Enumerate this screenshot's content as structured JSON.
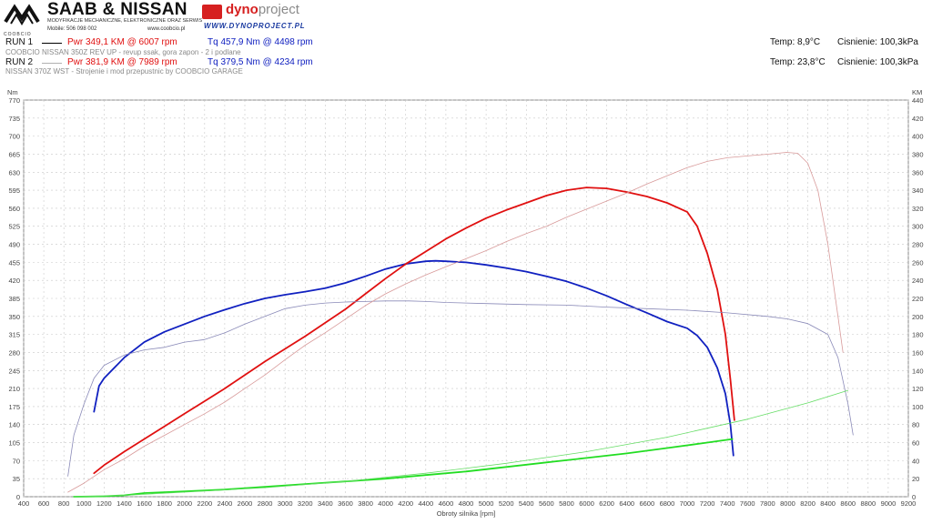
{
  "header": {
    "brand_title": "SAAB & NISSAN",
    "brand_subtitle": "MODYFIKACJE MECHANICZNE, ELEKTRONICZNE ORAZ SERWIS",
    "brand_phone": "Mobile: 506 098 002",
    "brand_web": "www.coobcio.pl",
    "brand_small": "COOBCIO",
    "dyno_name_a": "dyno",
    "dyno_name_b": "project",
    "dyno_url": "WWW.DYNOPROJECT.PL"
  },
  "runs": [
    {
      "label": "RUN 1",
      "power": "Pwr  349,1 KM @ 6007 rpm",
      "torque": "Tq 457,9 Nm @ 4498 rpm",
      "description": "COOBCIO NISSAN 350Z REV UP - revup ssak, gora zapon - 2 i podlane",
      "temp": "Temp: 8,9°C",
      "pressure": "Cisnienie: 100,3kPa",
      "line_color": "#000000"
    },
    {
      "label": "RUN 2",
      "power": "Pwr  381,9 KM @ 7989 rpm",
      "torque": "Tq 379,5 Nm @ 4234 rpm",
      "description": "NISSAN 370Z WST - Strojenie i mod przepustnic by COOBCIO GARAGE",
      "temp": "Temp: 23,8°C",
      "pressure": "Cisnienie: 100,3kPa",
      "line_color": "#b0b0b0"
    }
  ],
  "chart_data": {
    "type": "line",
    "xlabel": "Obroty silnika [rpm]",
    "ylabel_left": "Nm",
    "ylabel_right": "KM",
    "xlim": [
      400,
      9200
    ],
    "ylim_left": [
      0,
      770
    ],
    "ylim_right": [
      0,
      440
    ],
    "x_ticks": [
      400,
      600,
      800,
      1000,
      1200,
      1400,
      1600,
      1800,
      2000,
      2200,
      2400,
      2600,
      2800,
      3000,
      3200,
      3400,
      3600,
      3800,
      4000,
      4200,
      4400,
      4600,
      4800,
      5000,
      5200,
      5400,
      5600,
      5800,
      6000,
      6200,
      6400,
      6600,
      6800,
      7000,
      7200,
      7400,
      7600,
      7800,
      8000,
      8200,
      8400,
      8600,
      8800,
      9000,
      9200
    ],
    "y_ticks_left": [
      0,
      35,
      70,
      105,
      140,
      175,
      210,
      245,
      280,
      315,
      350,
      385,
      420,
      455,
      490,
      525,
      560,
      595,
      630,
      665,
      700,
      735,
      770
    ],
    "y_ticks_right": [
      0,
      20,
      40,
      60,
      80,
      100,
      120,
      140,
      160,
      180,
      200,
      220,
      240,
      260,
      280,
      300,
      320,
      340,
      360,
      380,
      400,
      420,
      440
    ],
    "grid": true,
    "series": [
      {
        "name": "RUN 1 Tq",
        "axis": "left",
        "color": "#1020c0",
        "width": 1.8,
        "points": [
          [
            1100,
            165
          ],
          [
            1150,
            215
          ],
          [
            1200,
            230
          ],
          [
            1400,
            270
          ],
          [
            1600,
            300
          ],
          [
            1800,
            320
          ],
          [
            2000,
            335
          ],
          [
            2200,
            350
          ],
          [
            2400,
            363
          ],
          [
            2600,
            375
          ],
          [
            2800,
            385
          ],
          [
            3000,
            392
          ],
          [
            3200,
            398
          ],
          [
            3400,
            405
          ],
          [
            3600,
            415
          ],
          [
            3800,
            428
          ],
          [
            4000,
            442
          ],
          [
            4200,
            452
          ],
          [
            4400,
            457
          ],
          [
            4498,
            458
          ],
          [
            4600,
            457
          ],
          [
            4800,
            455
          ],
          [
            5000,
            450
          ],
          [
            5200,
            444
          ],
          [
            5400,
            437
          ],
          [
            5600,
            428
          ],
          [
            5800,
            418
          ],
          [
            6000,
            405
          ],
          [
            6200,
            390
          ],
          [
            6400,
            373
          ],
          [
            6600,
            357
          ],
          [
            6800,
            340
          ],
          [
            7000,
            327
          ],
          [
            7100,
            313
          ],
          [
            7200,
            290
          ],
          [
            7300,
            250
          ],
          [
            7380,
            200
          ],
          [
            7430,
            140
          ],
          [
            7460,
            80
          ]
        ]
      },
      {
        "name": "RUN 1 Pwr",
        "axis": "right",
        "color": "#e01010",
        "width": 1.8,
        "points": [
          [
            1100,
            26
          ],
          [
            1200,
            35
          ],
          [
            1400,
            50
          ],
          [
            1600,
            64
          ],
          [
            1800,
            78
          ],
          [
            2000,
            92
          ],
          [
            2200,
            106
          ],
          [
            2400,
            120
          ],
          [
            2600,
            135
          ],
          [
            2800,
            150
          ],
          [
            3000,
            164
          ],
          [
            3200,
            178
          ],
          [
            3400,
            193
          ],
          [
            3600,
            208
          ],
          [
            3800,
            225
          ],
          [
            4000,
            242
          ],
          [
            4200,
            258
          ],
          [
            4400,
            272
          ],
          [
            4600,
            286
          ],
          [
            4800,
            298
          ],
          [
            5000,
            309
          ],
          [
            5200,
            318
          ],
          [
            5400,
            326
          ],
          [
            5600,
            334
          ],
          [
            5800,
            340
          ],
          [
            6000,
            343
          ],
          [
            6200,
            342
          ],
          [
            6400,
            338
          ],
          [
            6600,
            333
          ],
          [
            6800,
            326
          ],
          [
            7000,
            316
          ],
          [
            7100,
            300
          ],
          [
            7200,
            270
          ],
          [
            7300,
            230
          ],
          [
            7380,
            180
          ],
          [
            7430,
            130
          ],
          [
            7470,
            85
          ]
        ]
      },
      {
        "name": "RUN 1 Loss",
        "axis": "right",
        "color": "#22dd22",
        "width": 1.8,
        "points": [
          [
            900,
            0
          ],
          [
            1200,
            0.5
          ],
          [
            1400,
            1.5
          ],
          [
            1600,
            4
          ],
          [
            2000,
            6
          ],
          [
            2400,
            8
          ],
          [
            2800,
            11
          ],
          [
            3200,
            14
          ],
          [
            3600,
            17
          ],
          [
            4000,
            20
          ],
          [
            4400,
            24
          ],
          [
            4800,
            28
          ],
          [
            5200,
            33
          ],
          [
            5600,
            38
          ],
          [
            6000,
            43
          ],
          [
            6400,
            48
          ],
          [
            6800,
            54
          ],
          [
            7200,
            60
          ],
          [
            7450,
            64
          ]
        ]
      },
      {
        "name": "RUN 2 Tq",
        "axis": "left",
        "color": "#8a8ab8",
        "width": 0.8,
        "points": [
          [
            840,
            40
          ],
          [
            900,
            120
          ],
          [
            1000,
            180
          ],
          [
            1100,
            230
          ],
          [
            1200,
            255
          ],
          [
            1400,
            275
          ],
          [
            1600,
            285
          ],
          [
            1800,
            290
          ],
          [
            2000,
            300
          ],
          [
            2200,
            305
          ],
          [
            2400,
            318
          ],
          [
            2600,
            335
          ],
          [
            2800,
            350
          ],
          [
            3000,
            365
          ],
          [
            3200,
            372
          ],
          [
            3400,
            376
          ],
          [
            3600,
            378
          ],
          [
            3800,
            379
          ],
          [
            4000,
            380
          ],
          [
            4234,
            380
          ],
          [
            4400,
            379
          ],
          [
            4600,
            377
          ],
          [
            5000,
            375
          ],
          [
            5400,
            373
          ],
          [
            5800,
            372
          ],
          [
            6200,
            368
          ],
          [
            6600,
            365
          ],
          [
            7000,
            362
          ],
          [
            7400,
            357
          ],
          [
            7800,
            350
          ],
          [
            8000,
            345
          ],
          [
            8200,
            336
          ],
          [
            8400,
            315
          ],
          [
            8500,
            270
          ],
          [
            8600,
            180
          ],
          [
            8650,
            120
          ]
        ]
      },
      {
        "name": "RUN 2 Pwr",
        "axis": "right",
        "color": "#d89a9a",
        "width": 0.8,
        "points": [
          [
            840,
            5
          ],
          [
            1000,
            15
          ],
          [
            1200,
            30
          ],
          [
            1400,
            42
          ],
          [
            1600,
            56
          ],
          [
            1800,
            68
          ],
          [
            2000,
            80
          ],
          [
            2200,
            92
          ],
          [
            2400,
            105
          ],
          [
            2600,
            120
          ],
          [
            2800,
            135
          ],
          [
            3000,
            152
          ],
          [
            3200,
            168
          ],
          [
            3400,
            182
          ],
          [
            3600,
            197
          ],
          [
            3800,
            212
          ],
          [
            4000,
            225
          ],
          [
            4200,
            236
          ],
          [
            4400,
            246
          ],
          [
            4600,
            255
          ],
          [
            4800,
            264
          ],
          [
            5000,
            273
          ],
          [
            5200,
            283
          ],
          [
            5400,
            292
          ],
          [
            5600,
            300
          ],
          [
            5800,
            310
          ],
          [
            6000,
            319
          ],
          [
            6200,
            328
          ],
          [
            6400,
            337
          ],
          [
            6600,
            347
          ],
          [
            6800,
            356
          ],
          [
            7000,
            365
          ],
          [
            7200,
            372
          ],
          [
            7400,
            376
          ],
          [
            7600,
            378
          ],
          [
            7800,
            380
          ],
          [
            7989,
            382
          ],
          [
            8100,
            381
          ],
          [
            8200,
            370
          ],
          [
            8300,
            340
          ],
          [
            8400,
            280
          ],
          [
            8500,
            200
          ],
          [
            8550,
            160
          ]
        ]
      },
      {
        "name": "RUN 2 Loss",
        "axis": "right",
        "color": "#66dd66",
        "width": 0.8,
        "points": [
          [
            900,
            0
          ],
          [
            1400,
            1.5
          ],
          [
            2000,
            5
          ],
          [
            2800,
            10
          ],
          [
            3600,
            17
          ],
          [
            4400,
            26
          ],
          [
            5200,
            37
          ],
          [
            6000,
            50
          ],
          [
            6800,
            66
          ],
          [
            7600,
            86
          ],
          [
            8200,
            104
          ],
          [
            8600,
            118
          ]
        ]
      }
    ]
  }
}
